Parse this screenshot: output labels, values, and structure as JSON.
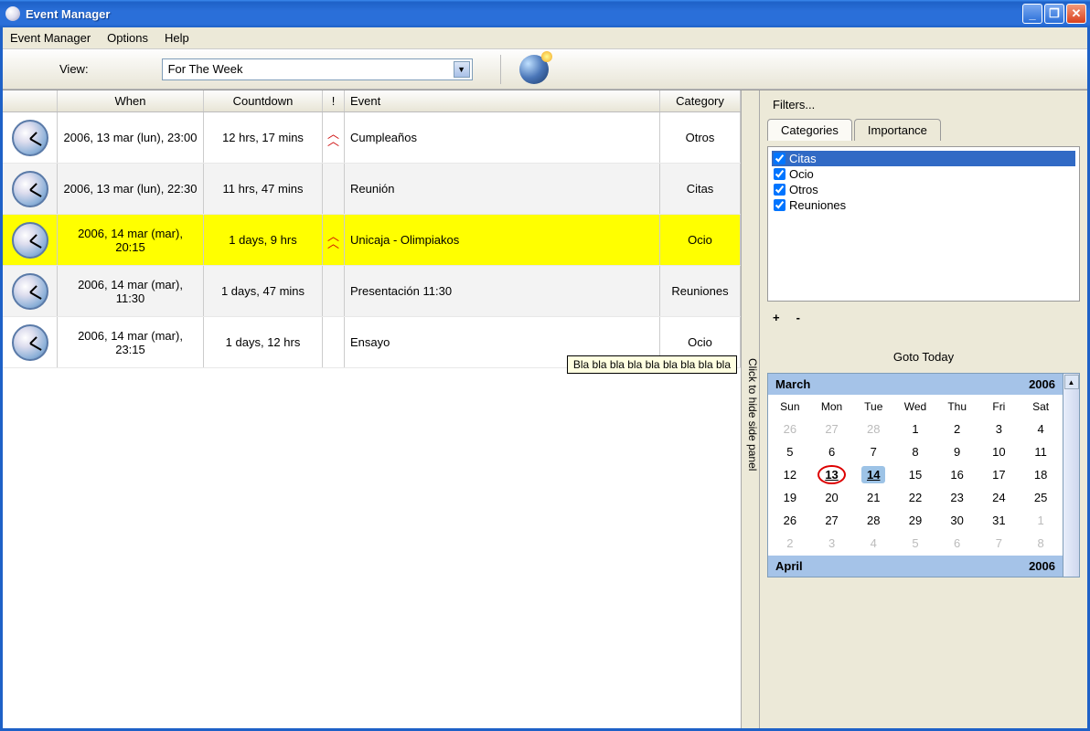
{
  "window": {
    "title": "Event Manager"
  },
  "menu": {
    "items": [
      "Event Manager",
      "Options",
      "Help"
    ]
  },
  "toolbar": {
    "view_label": "View:",
    "view_value": "For The Week"
  },
  "grid": {
    "headers": {
      "when": "When",
      "countdown": "Countdown",
      "excl": "!",
      "event": "Event",
      "category": "Category"
    },
    "rows": [
      {
        "when": "2006, 13 mar (lun), 23:00",
        "countdown": "12 hrs, 17 mins",
        "excl": true,
        "event": "Cumpleaños",
        "category": "Otros",
        "cls": ""
      },
      {
        "when": "2006, 13 mar (lun), 22:30",
        "countdown": "11 hrs, 47 mins",
        "excl": false,
        "event": "Reunión",
        "category": "Citas",
        "cls": "alt"
      },
      {
        "when": "2006, 14 mar (mar), 20:15",
        "countdown": "1 days, 9 hrs",
        "excl": true,
        "event": "Unicaja - Olimpiakos",
        "category": "Ocio",
        "cls": "hl"
      },
      {
        "when": "2006, 14 mar (mar), 11:30",
        "countdown": "1 days, 47 mins",
        "excl": false,
        "event": "Presentación 11:30",
        "category": "Reuniones",
        "cls": "alt"
      },
      {
        "when": "2006, 14 mar (mar), 23:15",
        "countdown": "1 days, 12 hrs",
        "excl": false,
        "event": "Ensayo",
        "category": "Ocio",
        "cls": ""
      }
    ],
    "tooltip": "Bla bla bla bla bla bla bla bla bla"
  },
  "side_toggle": "Click to hide side panel",
  "filters": {
    "label": "Filters...",
    "tabs": {
      "categories": "Categories",
      "importance": "Importance"
    },
    "items": [
      {
        "label": "Citas",
        "checked": true,
        "sel": true
      },
      {
        "label": "Ocio",
        "checked": true,
        "sel": false
      },
      {
        "label": "Otros",
        "checked": true,
        "sel": false
      },
      {
        "label": "Reuniones",
        "checked": true,
        "sel": false
      }
    ],
    "plus": "+",
    "minus": "-"
  },
  "goto_today": "Goto Today",
  "calendar": {
    "month1": "March",
    "year1": "2006",
    "dows": [
      "Sun",
      "Mon",
      "Tue",
      "Wed",
      "Thu",
      "Fri",
      "Sat"
    ],
    "weeks": [
      [
        {
          "d": "26",
          "dim": true
        },
        {
          "d": "27",
          "dim": true
        },
        {
          "d": "28",
          "dim": true
        },
        {
          "d": "1"
        },
        {
          "d": "2"
        },
        {
          "d": "3"
        },
        {
          "d": "4"
        }
      ],
      [
        {
          "d": "5"
        },
        {
          "d": "6"
        },
        {
          "d": "7"
        },
        {
          "d": "8"
        },
        {
          "d": "9"
        },
        {
          "d": "10"
        },
        {
          "d": "11"
        }
      ],
      [
        {
          "d": "12"
        },
        {
          "d": "13",
          "today": true
        },
        {
          "d": "14",
          "sel": true
        },
        {
          "d": "15"
        },
        {
          "d": "16"
        },
        {
          "d": "17"
        },
        {
          "d": "18"
        }
      ],
      [
        {
          "d": "19"
        },
        {
          "d": "20"
        },
        {
          "d": "21"
        },
        {
          "d": "22"
        },
        {
          "d": "23"
        },
        {
          "d": "24"
        },
        {
          "d": "25"
        }
      ],
      [
        {
          "d": "26"
        },
        {
          "d": "27"
        },
        {
          "d": "28"
        },
        {
          "d": "29"
        },
        {
          "d": "30"
        },
        {
          "d": "31"
        },
        {
          "d": "1",
          "dim": true
        }
      ],
      [
        {
          "d": "2",
          "dim": true
        },
        {
          "d": "3",
          "dim": true
        },
        {
          "d": "4",
          "dim": true
        },
        {
          "d": "5",
          "dim": true
        },
        {
          "d": "6",
          "dim": true
        },
        {
          "d": "7",
          "dim": true
        },
        {
          "d": "8",
          "dim": true
        }
      ]
    ],
    "month2": "April",
    "year2": "2006"
  }
}
